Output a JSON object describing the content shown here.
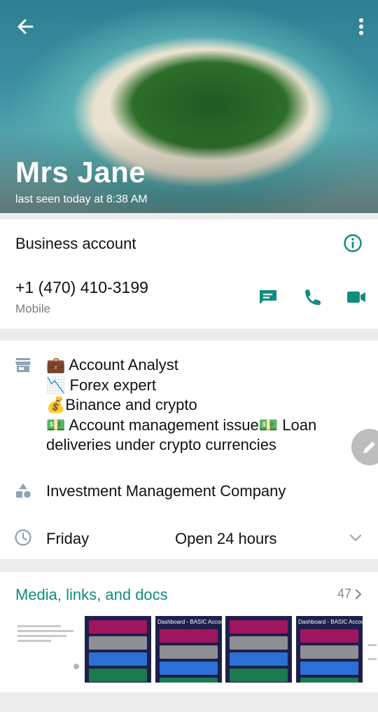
{
  "header": {
    "name": "Mrs Jane",
    "status": "last seen today at 8:38 AM",
    "back_icon": "arrow-left-icon",
    "menu_icon": "more-vertical-icon"
  },
  "contact": {
    "business_label": "Business account",
    "phone": "+1 (470) 410-3199",
    "phone_type": "Mobile",
    "accent": "#128c7e"
  },
  "business": {
    "description_lines": [
      "💼 Account Analyst",
      "📉 Forex expert",
      "💰Binance and crypto",
      "💵 Account management issue💵 Loan deliveries under crypto currencies"
    ],
    "category": "Investment Management Company",
    "hours_day": "Friday",
    "hours_value": "Open 24 hours"
  },
  "media": {
    "title": "Media, links, and docs",
    "count": "47",
    "dashboard_title": "Dashboard - BASIC Account"
  }
}
